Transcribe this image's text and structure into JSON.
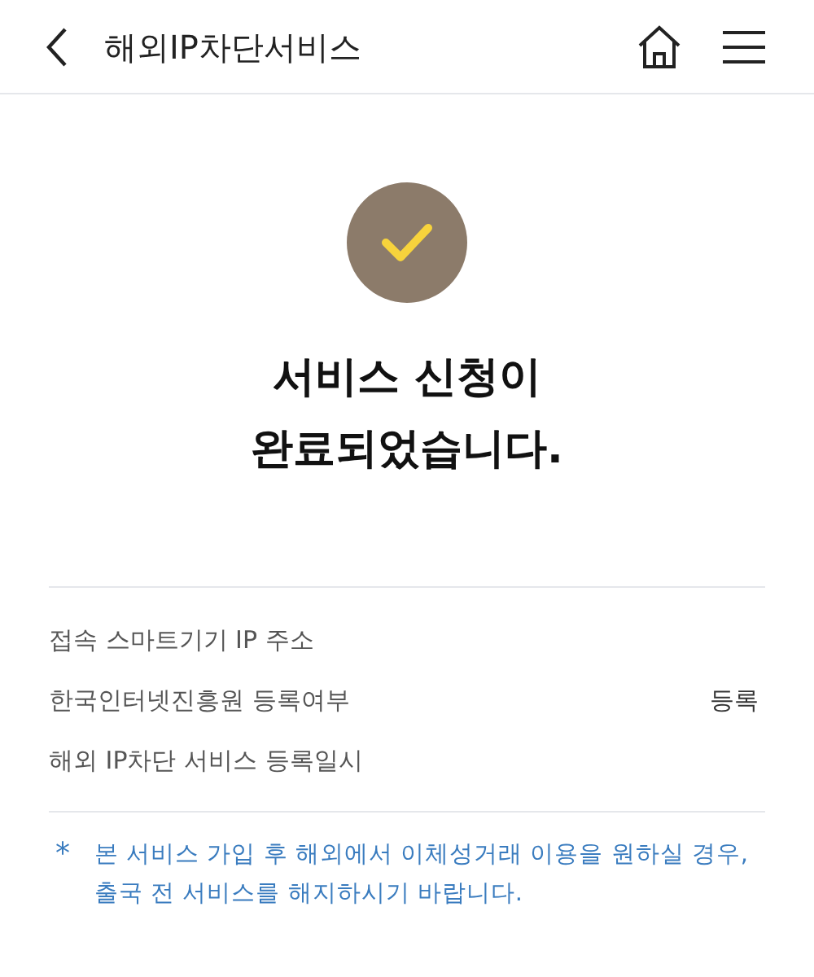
{
  "header": {
    "title": "해외IP차단서비스"
  },
  "result": {
    "lines": [
      "서비스 신청이",
      "완료되었습니다."
    ]
  },
  "info_rows": [
    {
      "label": "접속 스마트기기 IP 주소"
    },
    {
      "label": "한국인터넷진흥원 등록여부",
      "value": "등록"
    },
    {
      "label": "해외 IP차단 서비스 등록일시"
    }
  ],
  "notice": {
    "mark": "*",
    "text": "본 서비스 가입 후 해외에서 이체성거래 이용을 원하실 경우, 출국 전 서비스를 해지하시기 바랍니다."
  }
}
